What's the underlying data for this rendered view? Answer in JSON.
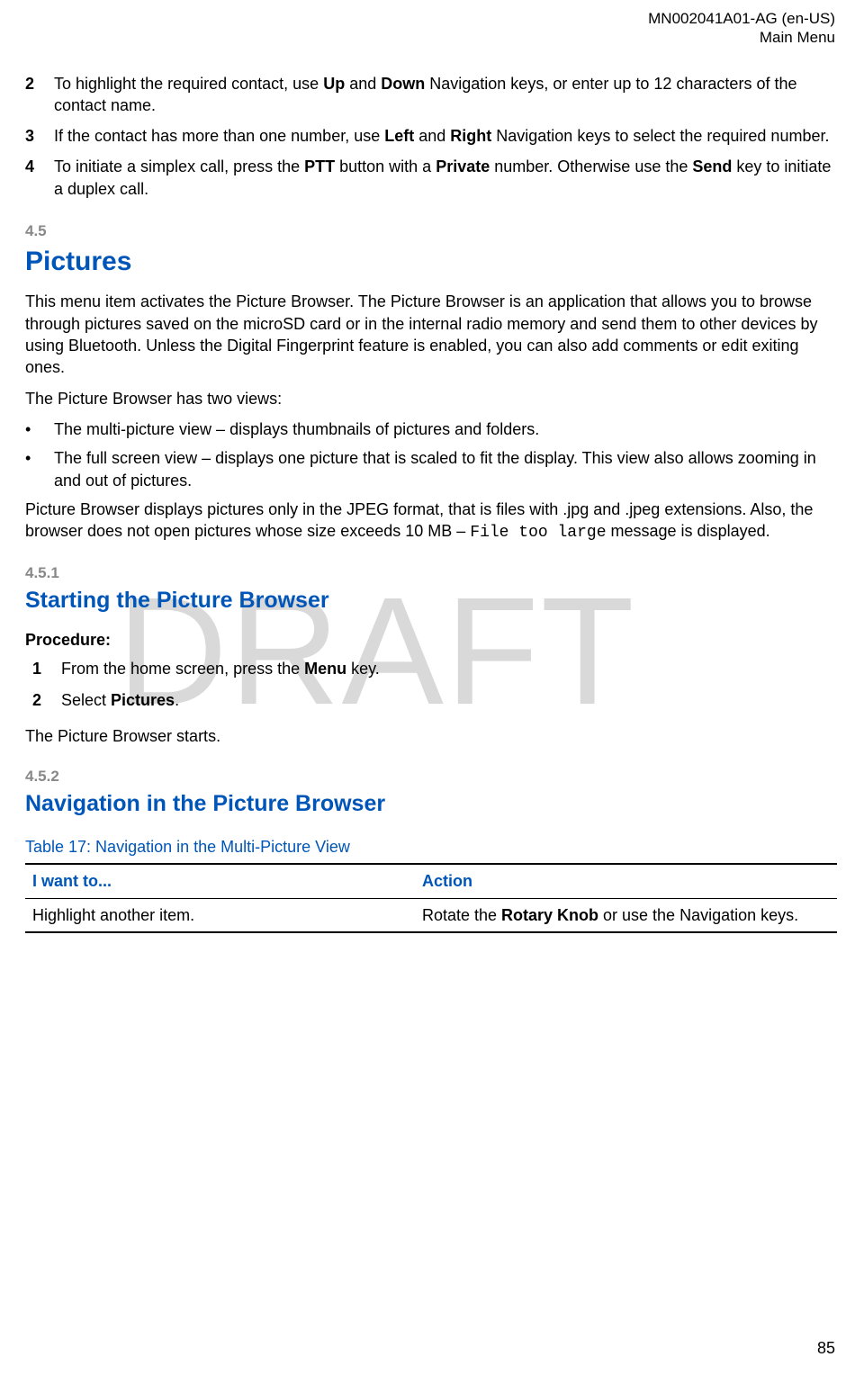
{
  "header": {
    "doc_id": "MN002041A01-AG (en-US)",
    "section": "Main Menu"
  },
  "steps_top": [
    {
      "num": "2",
      "pre": "To highlight the required contact, use ",
      "b1": "Up",
      "mid1": " and ",
      "b2": "Down",
      "post": " Navigation keys, or enter up to 12 characters of the contact name."
    },
    {
      "num": "3",
      "pre": "If the contact has more than one number, use ",
      "b1": "Left",
      "mid1": " and ",
      "b2": "Right",
      "post": " Navigation keys to select the required number."
    },
    {
      "num": "4",
      "pre": "To initiate a simplex call, press the ",
      "b1": "PTT",
      "mid1": " button with a ",
      "b2": "Private",
      "mid2": " number. Otherwise use the ",
      "b3": "Send",
      "post": " key to initiate a duplex call."
    }
  ],
  "sec45": {
    "num": "4.5",
    "title": "Pictures",
    "p1": "This menu item activates the Picture Browser. The Picture Browser is an application that allows you to browse through pictures saved on the microSD card or in the internal radio memory and send them to other devices by using Bluetooth. Unless the Digital Fingerprint feature is enabled, you can also add comments or edit exiting ones.",
    "p2": "The Picture Browser has two views:",
    "bullets": [
      "The multi-picture view – displays thumbnails of pictures and folders.",
      "The full screen view – displays one picture that is scaled to fit the display. This view also allows zooming in and out of pictures."
    ],
    "p3_pre": "Picture Browser displays pictures only in the JPEG format, that is files with .jpg and .jpeg extensions. Also, the browser does not open pictures whose size exceeds 10 MB – ",
    "p3_code": "File too large",
    "p3_post": " message is displayed."
  },
  "sec451": {
    "num": "4.5.1",
    "title": "Starting the Picture Browser",
    "proc_label": "Procedure:",
    "steps": [
      {
        "num": "1",
        "pre": "From the home screen, press the ",
        "b1": "Menu",
        "post": " key."
      },
      {
        "num": "2",
        "pre": "Select ",
        "b1": "Pictures",
        "post": "."
      }
    ],
    "result": "The Picture Browser starts."
  },
  "sec452": {
    "num": "4.5.2",
    "title": "Navigation in the Picture Browser",
    "table_title": "Table 17: Navigation in the Multi-Picture View",
    "th1": "I want to...",
    "th2": "Action",
    "row1_c1": "Highlight another item.",
    "row1_c2_pre": "Rotate the ",
    "row1_c2_b": "Rotary Knob",
    "row1_c2_post": " or use the Navigation keys."
  },
  "watermark": "DRAFT",
  "page_num": "85"
}
